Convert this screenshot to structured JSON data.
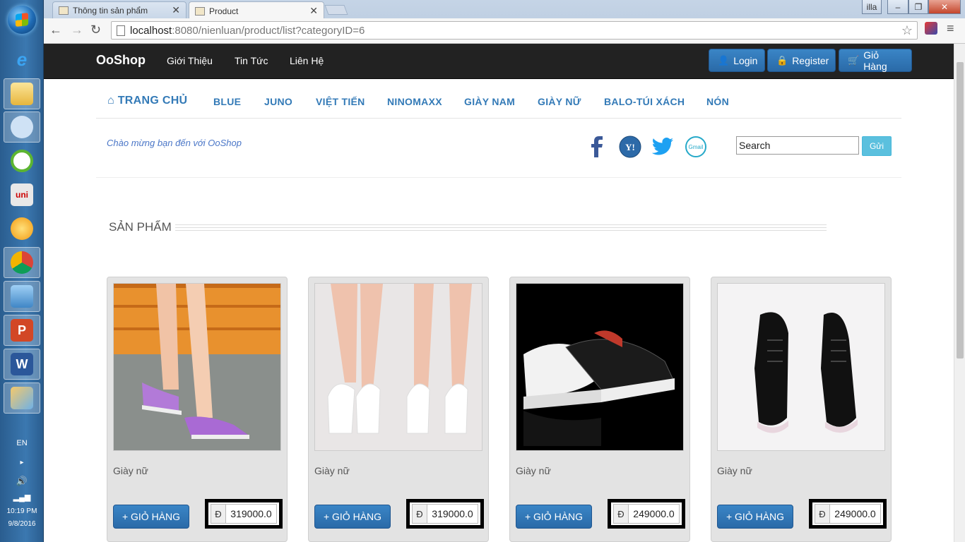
{
  "browser": {
    "tabs": [
      {
        "title": "Thông tin sản phẩm"
      },
      {
        "title": "Product"
      }
    ],
    "url_host": "localhost",
    "url_path": ":8080/nienluan/product/list?categoryID=6",
    "window_buttons": [
      "illa",
      "–",
      "❐",
      "✕"
    ]
  },
  "taskbar": {
    "lang": "EN",
    "time": "10:19 PM",
    "date": "9/8/2016"
  },
  "navbar": {
    "brand": "OoShop",
    "links": [
      "Giới Thiệu",
      "Tin Tức",
      "Liên Hệ"
    ],
    "buttons": {
      "login": "Login",
      "register": "Register",
      "cart": "Giỏ Hàng"
    }
  },
  "categories": {
    "home": "TRANG CHỦ",
    "items": [
      "BLUE",
      "JUNO",
      "VIỆT TIẾN",
      "NINOMAXX",
      "GIÀY NAM",
      "GIÀY NỮ",
      "BALO-TÚI XÁCH",
      "NÓN"
    ]
  },
  "welcome": "Chào mừng bạn đến với OoShop",
  "search": {
    "value": "Search",
    "button": "Gửi"
  },
  "section_title": "SẢN PHẨM",
  "products": [
    {
      "name": "Giày nữ",
      "add": "+ GIỎ HÀNG",
      "currency": "Đ",
      "price": "319000.0"
    },
    {
      "name": "Giày nữ",
      "add": "+ GIỎ HÀNG",
      "currency": "Đ",
      "price": "319000.0"
    },
    {
      "name": "Giày nữ",
      "add": "+ GIỎ HÀNG",
      "currency": "Đ",
      "price": "249000.0"
    },
    {
      "name": "Giày nữ",
      "add": "+ GIỎ HÀNG",
      "currency": "Đ",
      "price": "249000.0"
    }
  ]
}
